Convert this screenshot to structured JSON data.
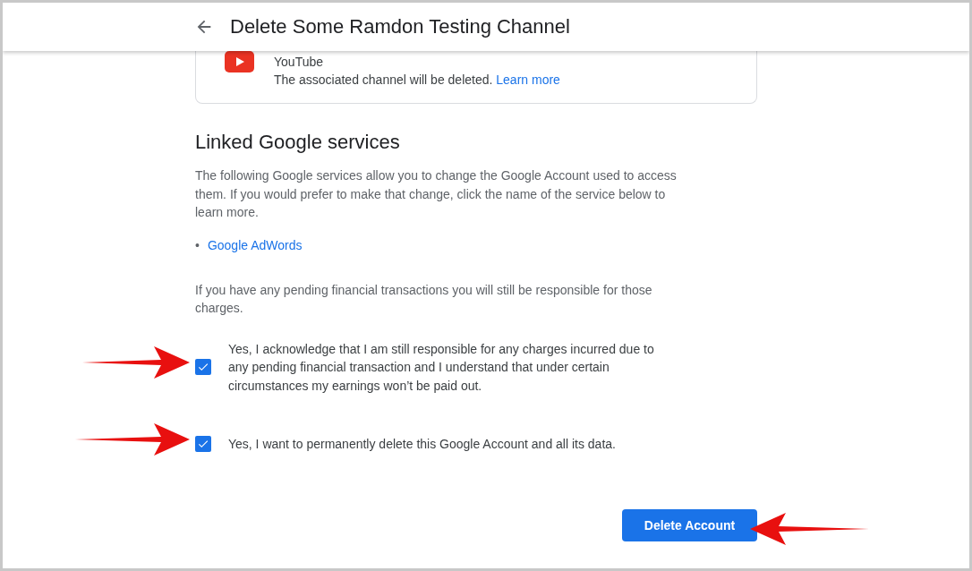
{
  "header": {
    "title": "Delete Some Ramdon Testing Channel"
  },
  "product_card": {
    "name": "YouTube",
    "description": "The associated channel will be deleted.",
    "link": "Learn more"
  },
  "linked_services": {
    "heading": "Linked Google services",
    "intro": "The following Google services allow you to change the Google Account used to access them. If you would prefer to make that change, click the name of the service below to learn more.",
    "services": [
      {
        "marker": "•",
        "name": "Google AdWords"
      }
    ]
  },
  "notice": "If you have any pending financial transactions you will still be responsible for those charges.",
  "confirmations": [
    {
      "label": "Yes, I acknowledge that I am still responsible for any charges incurred due to any pending financial transaction and I understand that under certain circumstances my earnings won’t be paid out.",
      "checked": true
    },
    {
      "label": "Yes, I want to permanently delete this Google Account and all its data.",
      "checked": true
    }
  ],
  "delete_button": "Delete Account"
}
